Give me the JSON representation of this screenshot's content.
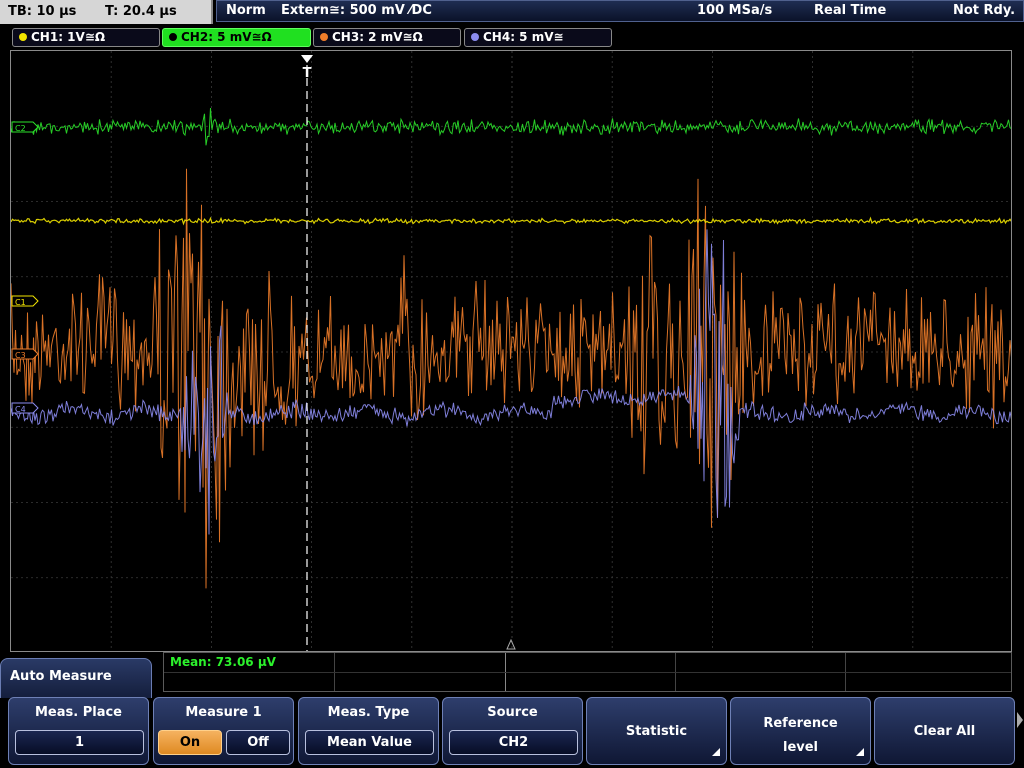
{
  "status": {
    "timebase": "TB: 10 µs",
    "trigger_time": "T: 20.4 µs",
    "mode": "Norm",
    "trigger": "Extern≅: 500 mV ⁄DC",
    "samplerate": "100 MSa/s",
    "acq": "Real Time",
    "state": "Not Rdy."
  },
  "channels": [
    {
      "label": "CH1: 1V≅Ω",
      "color": "#f2e400"
    },
    {
      "label": "CH2: 5 mV≅Ω",
      "color": "#2be22b"
    },
    {
      "label": "CH3: 2 mV≅Ω",
      "color": "#f07d2a"
    },
    {
      "label": "CH4: 5 mV≅",
      "color": "#8c8cf0"
    }
  ],
  "markers": {
    "c2": "C2",
    "c1": "C1",
    "c3": "C3",
    "c4": "C4",
    "trigger": "T"
  },
  "measurement": {
    "mean": "Mean: 73.06 µV"
  },
  "menu": {
    "title": "Auto Measure",
    "meas_place": {
      "title": "Meas. Place",
      "value": "1"
    },
    "measure1": {
      "title": "Measure 1",
      "on": "On",
      "off": "Off"
    },
    "meas_type": {
      "title": "Meas. Type",
      "value": "Mean Value"
    },
    "source": {
      "title": "Source",
      "value": "CH2"
    },
    "statistic": "Statistic",
    "reference_level": {
      "line1": "Reference",
      "line2": "level"
    },
    "clear_all": "Clear All"
  }
}
